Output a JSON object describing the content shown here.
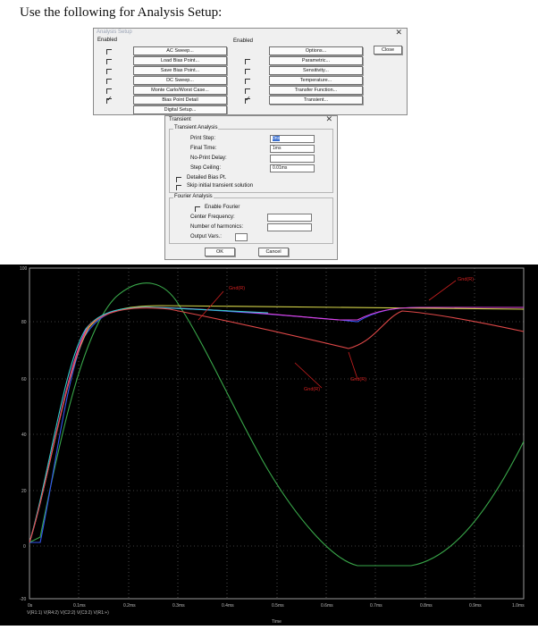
{
  "heading": "Use the following for Analysis Setup:",
  "analysis_setup": {
    "title": "Analysis Setup",
    "close_label": "Close",
    "enabled_label_left": "Enabled",
    "enabled_label_right": "Enabled",
    "left_items": [
      {
        "label": "AC Sweep...",
        "enabled": false
      },
      {
        "label": "Load Bias Point...",
        "enabled": false
      },
      {
        "label": "Save Bias Point...",
        "enabled": false
      },
      {
        "label": "DC Sweep...",
        "enabled": false
      },
      {
        "label": "Monte Carlo/Worst Case...",
        "enabled": false
      },
      {
        "label": "Bias Point Detail",
        "enabled": true
      },
      {
        "label": "Digital Setup...",
        "enabled": null
      }
    ],
    "right_items": [
      {
        "label": "Options...",
        "enabled": null
      },
      {
        "label": "Parametric...",
        "enabled": false
      },
      {
        "label": "Sensitivity...",
        "enabled": false
      },
      {
        "label": "Temperature...",
        "enabled": false
      },
      {
        "label": "Transfer Function...",
        "enabled": false
      },
      {
        "label": "Transient...",
        "enabled": true
      }
    ]
  },
  "transient": {
    "title": "Transient",
    "group_analysis": "Transient Analysis",
    "print_step_label": "Print Step:",
    "print_step_value": "0ns",
    "final_time_label": "Final Time:",
    "final_time_value": "1ms",
    "no_print_delay_label": "No-Print Delay:",
    "no_print_delay_value": "",
    "step_ceiling_label": "Step Ceiling:",
    "step_ceiling_value": "0.01ms",
    "detailed_bias_label": "Detailed Bias Pt.",
    "skip_initial_label": "Skip initial transient solution",
    "group_fourier": "Fourier Analysis",
    "enable_fourier_label": "Enable Fourier",
    "center_freq_label": "Center Frequency:",
    "num_harmonics_label": "Number of harmonics:",
    "output_vars_label": "Output Vars.:",
    "ok_label": "OK",
    "cancel_label": "Cancel"
  },
  "plot": {
    "y_ticks": [
      "100",
      "80",
      "60",
      "40",
      "20",
      "0",
      "-20"
    ],
    "x_ticks": [
      "0s",
      "0.1ms",
      "0.2ms",
      "0.3ms",
      "0.4ms",
      "0.5ms",
      "0.6ms",
      "0.7ms",
      "0.8ms",
      "0.9ms",
      "1.0ms"
    ],
    "x_axis_label": "Time",
    "legend": "V(R1:1)  V(R4:2)  V(C2:2)  V(C3:2)  V(R1:+)",
    "annotations": [
      "Gnd(R)",
      "Gnd(R)",
      "Gnd(R)",
      "Gnd(R)",
      "Gnd(R)"
    ]
  },
  "colors": {
    "dialog_bg": "#f0f0f0",
    "plot_bg": "#000000",
    "grid": "#8a8a8a",
    "green_trace": "#39a84a",
    "blue_trace": "#3355ee",
    "yellow_trace": "#d8d84a",
    "red_trace": "#e04848",
    "magenta_trace": "#e040e0",
    "cyan_trace": "#33cccc",
    "annotation_red": "#d42020"
  }
}
